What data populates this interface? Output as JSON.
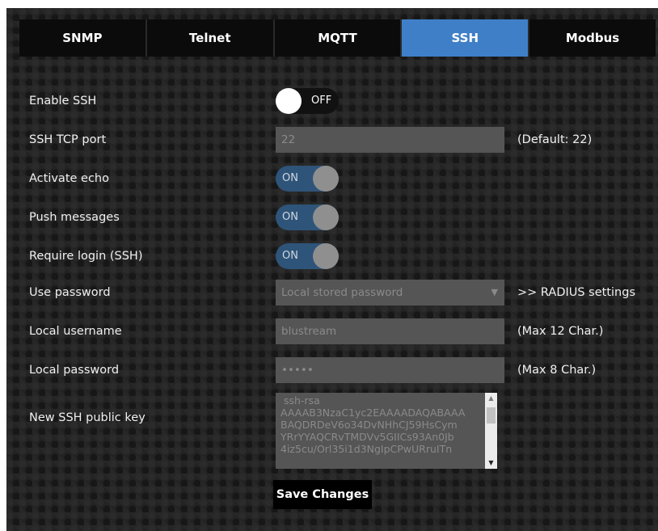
{
  "tabs": [
    {
      "label": "SNMP",
      "active": false
    },
    {
      "label": "Telnet",
      "active": false
    },
    {
      "label": "MQTT",
      "active": false
    },
    {
      "label": "SSH",
      "active": true
    },
    {
      "label": "Modbus",
      "active": false
    }
  ],
  "colors": {
    "active_tab": "#3f7fc8",
    "toggle_on": "#2e5479",
    "toggle_off": "#111111",
    "field_bg": "#555555",
    "page_bg": "#232323"
  },
  "form": {
    "enable_ssh": {
      "label": "Enable SSH",
      "state": "OFF"
    },
    "tcp_port": {
      "label": "SSH TCP port",
      "value": "22",
      "hint": "(Default: 22)"
    },
    "activate_echo": {
      "label": "Activate echo",
      "state": "ON"
    },
    "push_messages": {
      "label": "Push messages",
      "state": "ON"
    },
    "require_login": {
      "label": "Require login (SSH)",
      "state": "ON"
    },
    "use_password": {
      "label": "Use password",
      "selected": "Local stored password",
      "link": ">> RADIUS settings"
    },
    "local_username": {
      "label": "Local username",
      "value": "blustream",
      "hint": "(Max 12 Char.)"
    },
    "local_password": {
      "label": "Local password",
      "value": "•••••",
      "hint": "(Max 8 Char.)"
    },
    "public_key": {
      "label": "New SSH public key",
      "value": " ssh-rsa\nAAAAB3NzaC1yc2EAAAADAQABAAA\nBAQDRDeV6o34DvNHhCJ59HsCym\nYRrYYAQCRvTMDVv5GIICs93An0Jb\n4iz5cu/Orl35i1d3NgIpCPwURruITn"
    }
  },
  "save_label": "Save Changes"
}
